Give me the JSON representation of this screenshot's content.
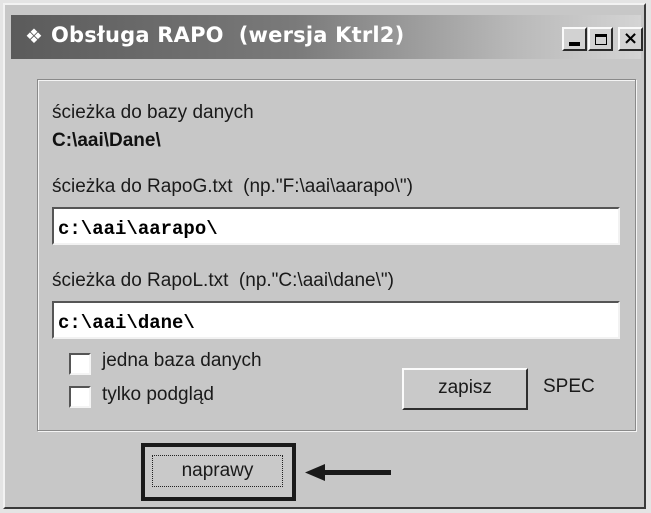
{
  "window": {
    "title": "Obsługa RAPO  (wersja Ktrl2)",
    "close_label": "×"
  },
  "form": {
    "db_path_label": "ścieżka do bazy danych",
    "db_path_value": "C:\\aai\\Dane\\",
    "rapog_label": "ścieżka do RapoG.txt  (np.\"F:\\aai\\aarapo\\\")",
    "rapog_value": "c:\\aai\\aarapo\\",
    "rapol_label": "ścieżka do RapoL.txt  (np.\"C:\\aai\\dane\\\")",
    "rapol_value": "c:\\aai\\dane\\",
    "checkbox_single_db": {
      "label": "jedna baza danych",
      "checked": false
    },
    "checkbox_preview_only": {
      "label": "tylko podgląd",
      "checked": false
    },
    "save_label": "zapisz",
    "spec_label": "SPEC"
  },
  "footer": {
    "repairs_label": "naprawy"
  },
  "icons": {
    "app": "app-icon",
    "minimize": "minimize-icon",
    "maximize": "maximize-icon",
    "close": "close-icon",
    "annotation_arrow": "arrow-left-icon"
  }
}
